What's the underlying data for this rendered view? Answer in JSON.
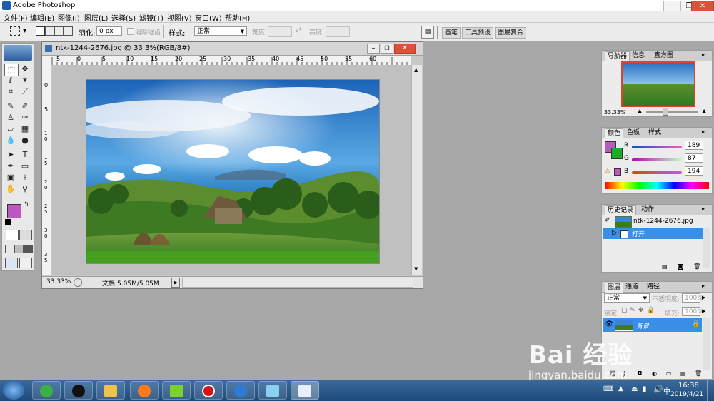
{
  "app": {
    "title": "Adobe Photoshop"
  },
  "menu": [
    "文件(F)",
    "编辑(E)",
    "图像(I)",
    "图层(L)",
    "选择(S)",
    "滤镜(T)",
    "视图(V)",
    "窗口(W)",
    "帮助(H)"
  ],
  "options": {
    "feather_label": "羽化:",
    "feather_value": "0 px",
    "antialias_label": "消除锯齿",
    "style_label": "样式:",
    "style_value": "正常",
    "width_label": "宽度:",
    "height_label": "高度:",
    "palette_tabs": [
      "画笔",
      "工具预设",
      "图层复合"
    ]
  },
  "document": {
    "title": "ntk-1244-2676.jpg @ 33.3%(RGB/8#)",
    "zoom": "33.33%",
    "doc_size": "文档:5.05M/5.05M",
    "ruler_h": [
      "5",
      "0",
      "5",
      "10",
      "15",
      "20",
      "25",
      "30",
      "35",
      "40",
      "45",
      "50",
      "55",
      "60"
    ],
    "ruler_v": [
      "0",
      "5",
      "1 0",
      "1 5",
      "2 0",
      "2 5",
      "3 0",
      "3 5"
    ]
  },
  "navigator": {
    "tabs": [
      "导航器",
      "信息",
      "直方图"
    ],
    "zoom": "33.33%"
  },
  "color": {
    "tabs": [
      "颜色",
      "色板",
      "样式"
    ],
    "r_label": "R",
    "r_value": "189",
    "g_label": "G",
    "g_value": "87",
    "b_label": "B",
    "b_value": "194",
    "foreground": "#bd57c2",
    "background": "#1faa2a"
  },
  "history": {
    "tabs": [
      "历史记录",
      "动作"
    ],
    "snapshot": "ntk-1244-2676.jpg",
    "items": [
      "打开"
    ]
  },
  "layers": {
    "tabs": [
      "图层",
      "通道",
      "路径"
    ],
    "blend": "正常",
    "opacity_label": "不透明度:",
    "opacity_value": "100%",
    "lock_label": "锁定:",
    "fill_label": "填充:",
    "fill_value": "100%",
    "layer_name": "背景"
  },
  "taskbar": {
    "time": "16:38",
    "date": "2019/4/21"
  },
  "watermark": {
    "brand": "Bai 经验",
    "url": "jingyan.baidu.com"
  },
  "colors": {
    "selection": "#3a8ee6",
    "taskbar": "#2a5a8c"
  }
}
